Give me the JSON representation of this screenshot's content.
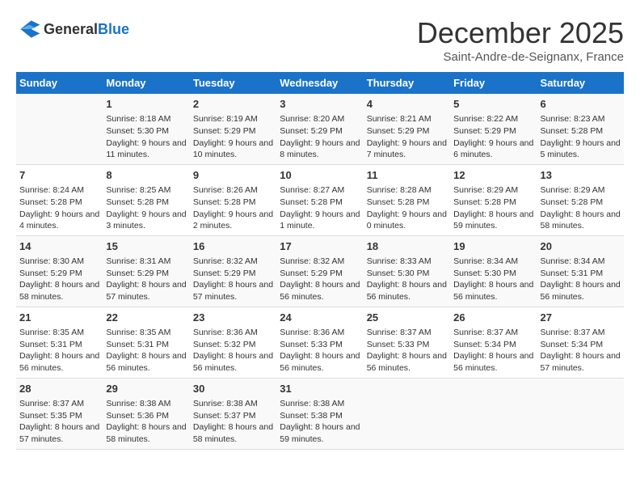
{
  "header": {
    "logo_general": "General",
    "logo_blue": "Blue",
    "month": "December 2025",
    "location": "Saint-Andre-de-Seignanx, France"
  },
  "weekdays": [
    "Sunday",
    "Monday",
    "Tuesday",
    "Wednesday",
    "Thursday",
    "Friday",
    "Saturday"
  ],
  "weeks": [
    [
      {
        "day": "",
        "sunrise": "",
        "sunset": "",
        "daylight": ""
      },
      {
        "day": "1",
        "sunrise": "Sunrise: 8:18 AM",
        "sunset": "Sunset: 5:30 PM",
        "daylight": "Daylight: 9 hours and 11 minutes."
      },
      {
        "day": "2",
        "sunrise": "Sunrise: 8:19 AM",
        "sunset": "Sunset: 5:29 PM",
        "daylight": "Daylight: 9 hours and 10 minutes."
      },
      {
        "day": "3",
        "sunrise": "Sunrise: 8:20 AM",
        "sunset": "Sunset: 5:29 PM",
        "daylight": "Daylight: 9 hours and 8 minutes."
      },
      {
        "day": "4",
        "sunrise": "Sunrise: 8:21 AM",
        "sunset": "Sunset: 5:29 PM",
        "daylight": "Daylight: 9 hours and 7 minutes."
      },
      {
        "day": "5",
        "sunrise": "Sunrise: 8:22 AM",
        "sunset": "Sunset: 5:29 PM",
        "daylight": "Daylight: 9 hours and 6 minutes."
      },
      {
        "day": "6",
        "sunrise": "Sunrise: 8:23 AM",
        "sunset": "Sunset: 5:28 PM",
        "daylight": "Daylight: 9 hours and 5 minutes."
      }
    ],
    [
      {
        "day": "7",
        "sunrise": "Sunrise: 8:24 AM",
        "sunset": "Sunset: 5:28 PM",
        "daylight": "Daylight: 9 hours and 4 minutes."
      },
      {
        "day": "8",
        "sunrise": "Sunrise: 8:25 AM",
        "sunset": "Sunset: 5:28 PM",
        "daylight": "Daylight: 9 hours and 3 minutes."
      },
      {
        "day": "9",
        "sunrise": "Sunrise: 8:26 AM",
        "sunset": "Sunset: 5:28 PM",
        "daylight": "Daylight: 9 hours and 2 minutes."
      },
      {
        "day": "10",
        "sunrise": "Sunrise: 8:27 AM",
        "sunset": "Sunset: 5:28 PM",
        "daylight": "Daylight: 9 hours and 1 minute."
      },
      {
        "day": "11",
        "sunrise": "Sunrise: 8:28 AM",
        "sunset": "Sunset: 5:28 PM",
        "daylight": "Daylight: 9 hours and 0 minutes."
      },
      {
        "day": "12",
        "sunrise": "Sunrise: 8:29 AM",
        "sunset": "Sunset: 5:28 PM",
        "daylight": "Daylight: 8 hours and 59 minutes."
      },
      {
        "day": "13",
        "sunrise": "Sunrise: 8:29 AM",
        "sunset": "Sunset: 5:28 PM",
        "daylight": "Daylight: 8 hours and 58 minutes."
      }
    ],
    [
      {
        "day": "14",
        "sunrise": "Sunrise: 8:30 AM",
        "sunset": "Sunset: 5:29 PM",
        "daylight": "Daylight: 8 hours and 58 minutes."
      },
      {
        "day": "15",
        "sunrise": "Sunrise: 8:31 AM",
        "sunset": "Sunset: 5:29 PM",
        "daylight": "Daylight: 8 hours and 57 minutes."
      },
      {
        "day": "16",
        "sunrise": "Sunrise: 8:32 AM",
        "sunset": "Sunset: 5:29 PM",
        "daylight": "Daylight: 8 hours and 57 minutes."
      },
      {
        "day": "17",
        "sunrise": "Sunrise: 8:32 AM",
        "sunset": "Sunset: 5:29 PM",
        "daylight": "Daylight: 8 hours and 56 minutes."
      },
      {
        "day": "18",
        "sunrise": "Sunrise: 8:33 AM",
        "sunset": "Sunset: 5:30 PM",
        "daylight": "Daylight: 8 hours and 56 minutes."
      },
      {
        "day": "19",
        "sunrise": "Sunrise: 8:34 AM",
        "sunset": "Sunset: 5:30 PM",
        "daylight": "Daylight: 8 hours and 56 minutes."
      },
      {
        "day": "20",
        "sunrise": "Sunrise: 8:34 AM",
        "sunset": "Sunset: 5:31 PM",
        "daylight": "Daylight: 8 hours and 56 minutes."
      }
    ],
    [
      {
        "day": "21",
        "sunrise": "Sunrise: 8:35 AM",
        "sunset": "Sunset: 5:31 PM",
        "daylight": "Daylight: 8 hours and 56 minutes."
      },
      {
        "day": "22",
        "sunrise": "Sunrise: 8:35 AM",
        "sunset": "Sunset: 5:31 PM",
        "daylight": "Daylight: 8 hours and 56 minutes."
      },
      {
        "day": "23",
        "sunrise": "Sunrise: 8:36 AM",
        "sunset": "Sunset: 5:32 PM",
        "daylight": "Daylight: 8 hours and 56 minutes."
      },
      {
        "day": "24",
        "sunrise": "Sunrise: 8:36 AM",
        "sunset": "Sunset: 5:33 PM",
        "daylight": "Daylight: 8 hours and 56 minutes."
      },
      {
        "day": "25",
        "sunrise": "Sunrise: 8:37 AM",
        "sunset": "Sunset: 5:33 PM",
        "daylight": "Daylight: 8 hours and 56 minutes."
      },
      {
        "day": "26",
        "sunrise": "Sunrise: 8:37 AM",
        "sunset": "Sunset: 5:34 PM",
        "daylight": "Daylight: 8 hours and 56 minutes."
      },
      {
        "day": "27",
        "sunrise": "Sunrise: 8:37 AM",
        "sunset": "Sunset: 5:34 PM",
        "daylight": "Daylight: 8 hours and 57 minutes."
      }
    ],
    [
      {
        "day": "28",
        "sunrise": "Sunrise: 8:37 AM",
        "sunset": "Sunset: 5:35 PM",
        "daylight": "Daylight: 8 hours and 57 minutes."
      },
      {
        "day": "29",
        "sunrise": "Sunrise: 8:38 AM",
        "sunset": "Sunset: 5:36 PM",
        "daylight": "Daylight: 8 hours and 58 minutes."
      },
      {
        "day": "30",
        "sunrise": "Sunrise: 8:38 AM",
        "sunset": "Sunset: 5:37 PM",
        "daylight": "Daylight: 8 hours and 58 minutes."
      },
      {
        "day": "31",
        "sunrise": "Sunrise: 8:38 AM",
        "sunset": "Sunset: 5:38 PM",
        "daylight": "Daylight: 8 hours and 59 minutes."
      },
      {
        "day": "",
        "sunrise": "",
        "sunset": "",
        "daylight": ""
      },
      {
        "day": "",
        "sunrise": "",
        "sunset": "",
        "daylight": ""
      },
      {
        "day": "",
        "sunrise": "",
        "sunset": "",
        "daylight": ""
      }
    ]
  ]
}
